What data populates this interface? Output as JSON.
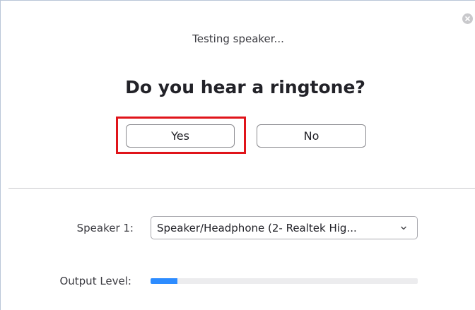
{
  "dialog": {
    "status_text": "Testing speaker...",
    "question": "Do you hear a ringtone?",
    "close_icon": "close-icon"
  },
  "buttons": {
    "yes_label": "Yes",
    "no_label": "No"
  },
  "speaker": {
    "label": "Speaker 1:",
    "selected_value": "Speaker/Headphone (2- Realtek Hig...",
    "dropdown_icon": "chevron-down-icon"
  },
  "output": {
    "label": "Output Level:",
    "level_fraction": 0.1
  },
  "colors": {
    "accent": "#2d8cff",
    "highlight": "#e0141a"
  }
}
